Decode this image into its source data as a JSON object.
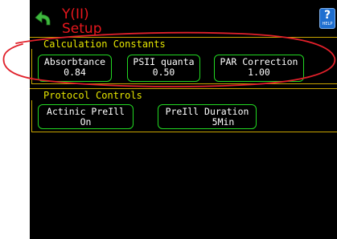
{
  "header": {
    "title_line1": "Y(II)",
    "title_line2": "Setup",
    "back_icon": "back-arrow-icon",
    "help_button": {
      "symbol": "?",
      "label": "HELP"
    }
  },
  "sections": {
    "calculation": {
      "title": "Calculation Constants",
      "controls": [
        {
          "label": "Absorbtance",
          "value": "0.84"
        },
        {
          "label": "PSII quanta",
          "value": "0.50"
        },
        {
          "label": "PAR Correction",
          "value": "1.00"
        }
      ]
    },
    "protocol": {
      "title": "Protocol Controls",
      "controls": [
        {
          "label": "Actinic PreIll",
          "value": "On"
        },
        {
          "label": "PreIll Duration",
          "value": "5Min"
        }
      ]
    }
  },
  "colors": {
    "screen_background": "#000000",
    "title": "#e8171d",
    "section_title": "#e6e600",
    "control_border": "#22d822",
    "annotation_ellipse": "#e0202a",
    "help_button": "#1f6fd0"
  }
}
